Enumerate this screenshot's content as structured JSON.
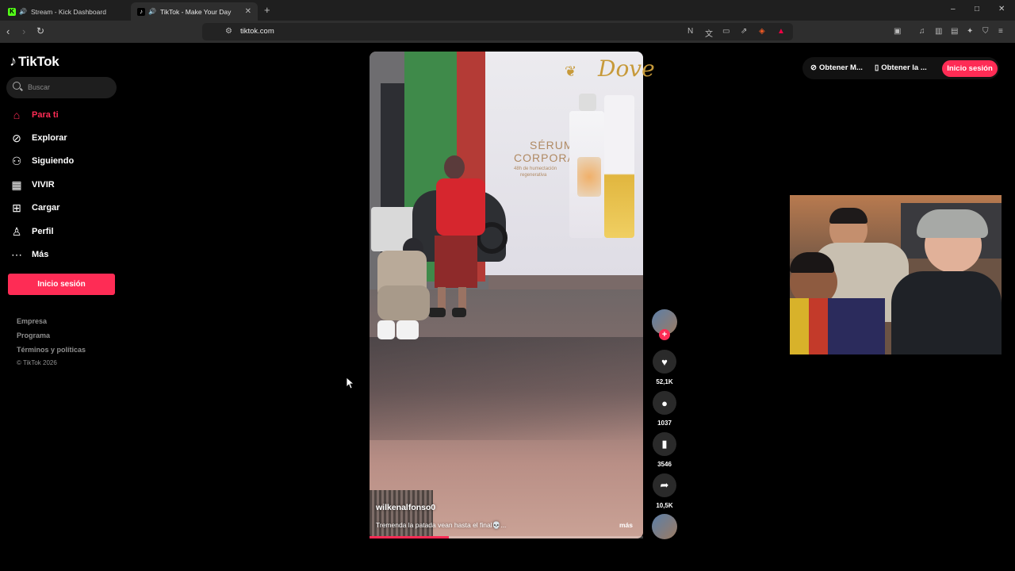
{
  "browser": {
    "tabs": [
      {
        "title": "Stream - Kick Dashboard",
        "favicon": "K",
        "active": false
      },
      {
        "title": "TikTok - Make Your Day",
        "favicon": "♪",
        "active": true
      }
    ],
    "url": "tiktok.com",
    "new_tab": "+",
    "window_controls": {
      "minimize": "–",
      "maximize": "□",
      "close": "✕"
    }
  },
  "sidebar": {
    "logo_text": "TikTok",
    "search_placeholder": "Buscar",
    "items": [
      {
        "label": "Para ti",
        "icon": "home-icon",
        "active": true
      },
      {
        "label": "Explorar",
        "icon": "compass-icon",
        "active": false
      },
      {
        "label": "Siguiendo",
        "icon": "following-icon",
        "active": false
      },
      {
        "label": "VIVIR",
        "icon": "live-icon",
        "active": false
      },
      {
        "label": "Cargar",
        "icon": "upload-icon",
        "active": false
      },
      {
        "label": "Perfil",
        "icon": "profile-icon",
        "active": false
      },
      {
        "label": "Más",
        "icon": "more-icon",
        "active": false
      }
    ],
    "login_button": "Inicio sesión",
    "footer_links": [
      "Empresa",
      "Programa",
      "Términos y políticas"
    ],
    "copyright": "© TikTok 2026"
  },
  "header_right": {
    "get_coins": "Obtener M...",
    "get_app": "Obtener la ...",
    "login_button": "Inicio sesión"
  },
  "video": {
    "username": "wilkenalfonso0",
    "description": "Tremenda la patada vean hasta el final💀...",
    "more": "más",
    "billboard_brand": "Dove",
    "billboard_line1": "SÉRUM",
    "billboard_line2": "CORPORAL",
    "billboard_line3": "48h de humectación",
    "billboard_line4": "regenerativa",
    "progress_fraction": 0.29
  },
  "actions": {
    "likes": "52,1K",
    "comments": "1037",
    "saves": "3546",
    "shares": "10,5K"
  },
  "colors": {
    "accent": "#fe2c55",
    "background": "#000000",
    "browser_toolbar": "#2e2e2e"
  }
}
